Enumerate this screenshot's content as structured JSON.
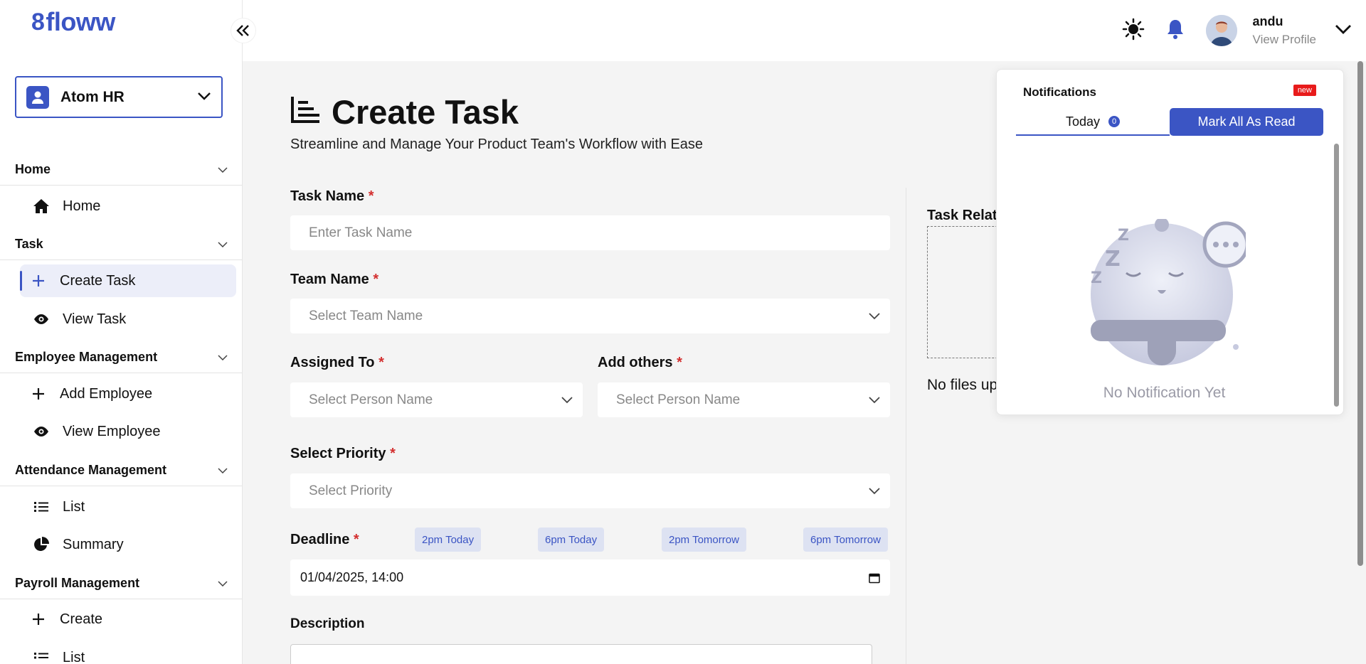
{
  "app": {
    "logo_text": "floww",
    "logo_mark": "8"
  },
  "org_selector": {
    "value": "Atom HR"
  },
  "sidebar": {
    "sections": [
      {
        "title": "Home",
        "items": [
          {
            "label": "Home",
            "icon": "home-icon"
          }
        ]
      },
      {
        "title": "Task",
        "items": [
          {
            "label": "Create Task",
            "icon": "plus-icon",
            "active": true
          },
          {
            "label": "View Task",
            "icon": "eye-icon"
          }
        ]
      },
      {
        "title": "Employee Management",
        "items": [
          {
            "label": "Add Employee",
            "icon": "plus-icon"
          },
          {
            "label": "View Employee",
            "icon": "eye-icon"
          }
        ]
      },
      {
        "title": "Attendance Management",
        "items": [
          {
            "label": "List",
            "icon": "list-icon"
          },
          {
            "label": "Summary",
            "icon": "pie-chart-icon"
          }
        ]
      },
      {
        "title": "Payroll Management",
        "items": [
          {
            "label": "Create",
            "icon": "plus-icon"
          },
          {
            "label": "List",
            "icon": "list-icon"
          }
        ]
      }
    ]
  },
  "header": {
    "user_name": "andu",
    "user_link": "View Profile"
  },
  "page": {
    "title": "Create Task",
    "subtitle": "Streamline and Manage Your Product Team's Workflow with Ease"
  },
  "form": {
    "task_name": {
      "label": "Task Name",
      "placeholder": "Enter Task Name"
    },
    "team_name": {
      "label": "Team Name",
      "placeholder": "Select Team Name"
    },
    "assigned_to": {
      "label": "Assigned To",
      "placeholder": "Select Person Name"
    },
    "add_others": {
      "label": "Add others",
      "placeholder": "Select Person Name"
    },
    "priority": {
      "label": "Select Priority",
      "placeholder": "Select Priority"
    },
    "deadline": {
      "label": "Deadline",
      "value": "01/04/2025, 14:00",
      "chips": [
        "2pm Today",
        "6pm Today",
        "2pm Tomorrow",
        "6pm Tomorrow"
      ]
    },
    "description": {
      "label": "Description"
    },
    "required_mark": "*"
  },
  "upload": {
    "label": "Task Relate",
    "status": "No files up"
  },
  "notifications": {
    "title": "Notifications",
    "badge": "new",
    "tab_label": "Today",
    "tab_count": "0",
    "mark_all": "Mark All As Read",
    "empty": "No Notification Yet"
  },
  "colors": {
    "accent": "#3b55c4",
    "required": "#d32f2f",
    "badge": "#e81b1b"
  }
}
